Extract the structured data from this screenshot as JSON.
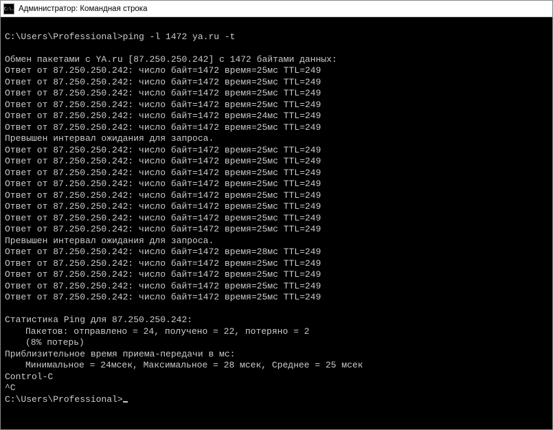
{
  "titlebar": {
    "icon_label": "C:\\.",
    "title": "Администратор: Командная строка"
  },
  "prompt1": "C:\\Users\\Professional>",
  "command1": "ping -l 1472 ya.ru -t",
  "blank": "",
  "exchange": "Обмен пакетами с YA.ru [87.250.250.242] с 1472 байтами данных:",
  "r1": "Ответ от 87.250.250.242: число байт=1472 время=25мс TTL=249",
  "r2": "Ответ от 87.250.250.242: число байт=1472 время=25мс TTL=249",
  "r3": "Ответ от 87.250.250.242: число байт=1472 время=25мс TTL=249",
  "r4": "Ответ от 87.250.250.242: число байт=1472 время=25мс TTL=249",
  "r5": "Ответ от 87.250.250.242: число байт=1472 время=24мс TTL=249",
  "r6": "Ответ от 87.250.250.242: число байт=1472 время=25мс TTL=249",
  "timeout1": "Превышен интервал ожидания для запроса.",
  "r7": "Ответ от 87.250.250.242: число байт=1472 время=25мс TTL=249",
  "r8": "Ответ от 87.250.250.242: число байт=1472 время=25мс TTL=249",
  "r9": "Ответ от 87.250.250.242: число байт=1472 время=25мс TTL=249",
  "r10": "Ответ от 87.250.250.242: число байт=1472 время=25мс TTL=249",
  "r11": "Ответ от 87.250.250.242: число байт=1472 время=25мс TTL=249",
  "r12": "Ответ от 87.250.250.242: число байт=1472 время=25мс TTL=249",
  "r13": "Ответ от 87.250.250.242: число байт=1472 время=25мс TTL=249",
  "r14": "Ответ от 87.250.250.242: число байт=1472 время=25мс TTL=249",
  "timeout2": "Превышен интервал ожидания для запроса.",
  "r15": "Ответ от 87.250.250.242: число байт=1472 время=28мс TTL=249",
  "r16": "Ответ от 87.250.250.242: число байт=1472 время=25мс TTL=249",
  "r17": "Ответ от 87.250.250.242: число байт=1472 время=25мс TTL=249",
  "r18": "Ответ от 87.250.250.242: число байт=1472 время=25мс TTL=249",
  "r19": "Ответ от 87.250.250.242: число байт=1472 время=25мс TTL=249",
  "stats_header": "Статистика Ping для 87.250.250.242:",
  "stats_packets": "Пакетов: отправлено = 24, получено = 22, потеряно = 2",
  "stats_loss": "(8% потерь)",
  "rtt_header": "Приблизительное время приема-передачи в мс:",
  "rtt_values": "Минимальное = 24мсек, Максимальное = 28 мсек, Среднее = 25 мсек",
  "ctrl_c": "Control-C",
  "caret_c": "^C",
  "prompt2": "C:\\Users\\Professional>"
}
